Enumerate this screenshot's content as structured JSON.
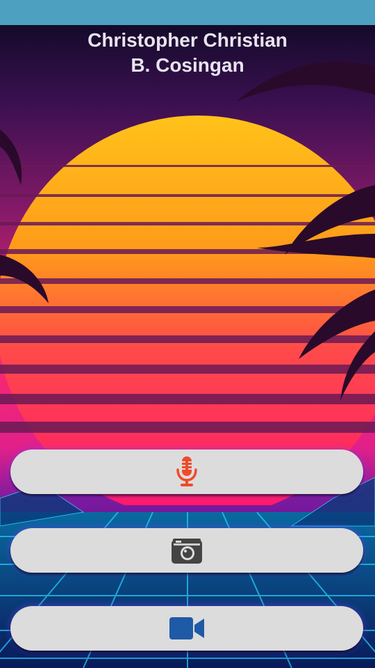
{
  "app": {
    "title_line1": "Christopher Christian",
    "title_line2": "B. Cosingan"
  },
  "buttons": [
    {
      "name": "record-audio-button",
      "icon": "microphone-icon",
      "icon_color": "#f04a2a"
    },
    {
      "name": "take-photo-button",
      "icon": "camera-icon",
      "icon_color": "#444444"
    },
    {
      "name": "record-video-button",
      "icon": "video-camera-icon",
      "icon_color": "#1f5aa6"
    }
  ],
  "colors": {
    "status_bar": "#4ea0c0",
    "button_bg": "#dcdcdc",
    "title_text": "#e8e4ee"
  }
}
